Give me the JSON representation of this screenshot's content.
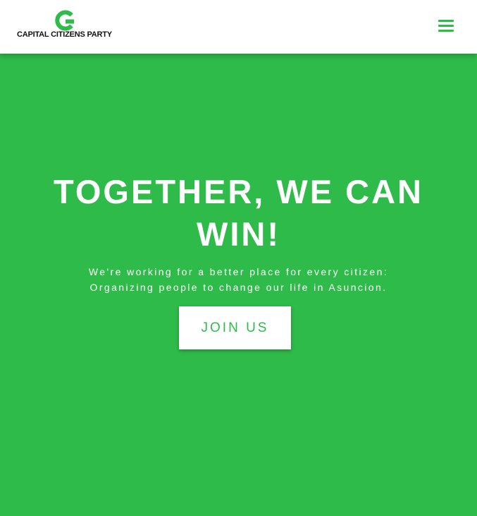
{
  "header": {
    "logo_text": "CAPITAL CITIZENS PARTY",
    "logo_icon": "c-logo-icon",
    "menu_icon": "hamburger-menu-icon"
  },
  "hero": {
    "title": "TOGETHER, WE CAN WIN!",
    "subtitle_line1": "We're working for a better place for every citizen:",
    "subtitle_line2": "Organizing people to change our life in Asuncion.",
    "cta_label": "JOIN US"
  },
  "colors": {
    "brand_green": "#2fbb4a",
    "header_background": "#ffffff",
    "text_on_green": "#ffffff",
    "logo_text": "#111111"
  }
}
